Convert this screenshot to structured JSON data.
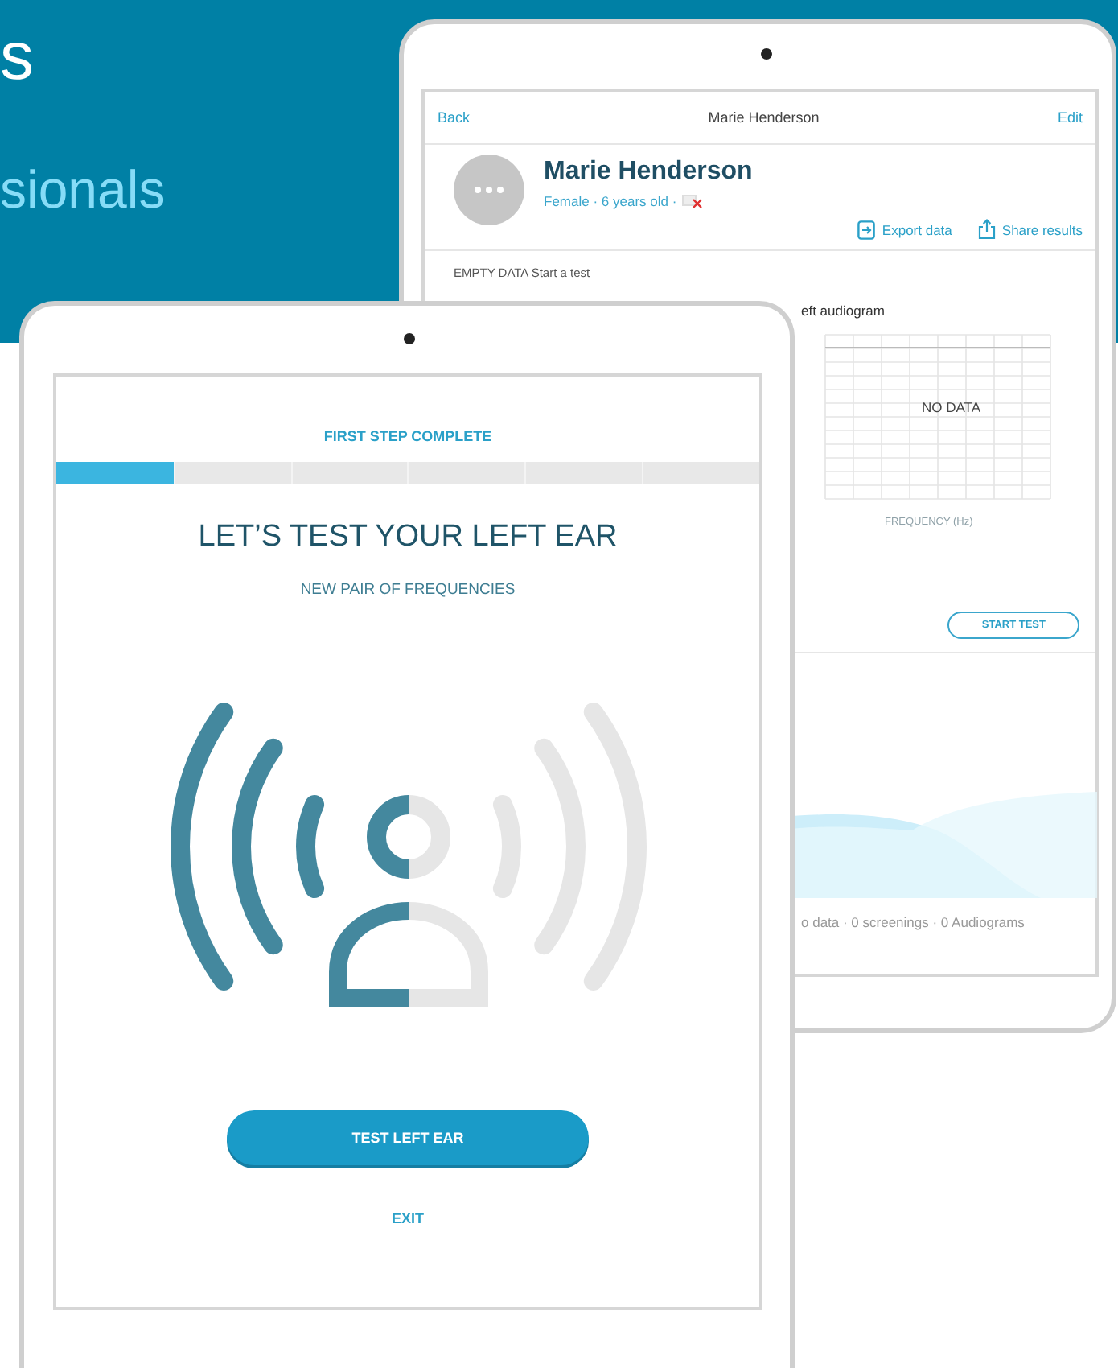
{
  "banner": {
    "heading": "s",
    "subheading": "sionals"
  },
  "back_tablet": {
    "nav": {
      "back": "Back",
      "title": "Marie Henderson",
      "edit": "Edit"
    },
    "profile": {
      "name": "Marie Henderson",
      "details": "Female · 6 years old ·"
    },
    "actions": [
      {
        "kind": "export",
        "label": "Export data"
      },
      {
        "kind": "share",
        "label": "Share results"
      }
    ],
    "status": "EMPTY DATA Start a test",
    "audiogram": {
      "title": "eft audiogram",
      "empty_text": "NO DATA",
      "x_axis_label": "FREQUENCY (Hz)"
    },
    "start_button": "START TEST",
    "summary": "o data · 0 screenings · 0 Audiograms"
  },
  "front_tablet": {
    "step_label": "FIRST STEP COMPLETE",
    "progress": {
      "level": 0.1667
    },
    "heading": "LET’S TEST YOUR LEFT EAR",
    "subheading": "NEW PAIR OF FREQUENCIES",
    "primary_button": "TEST LEFT EAR",
    "exit_link": "EXIT"
  }
}
